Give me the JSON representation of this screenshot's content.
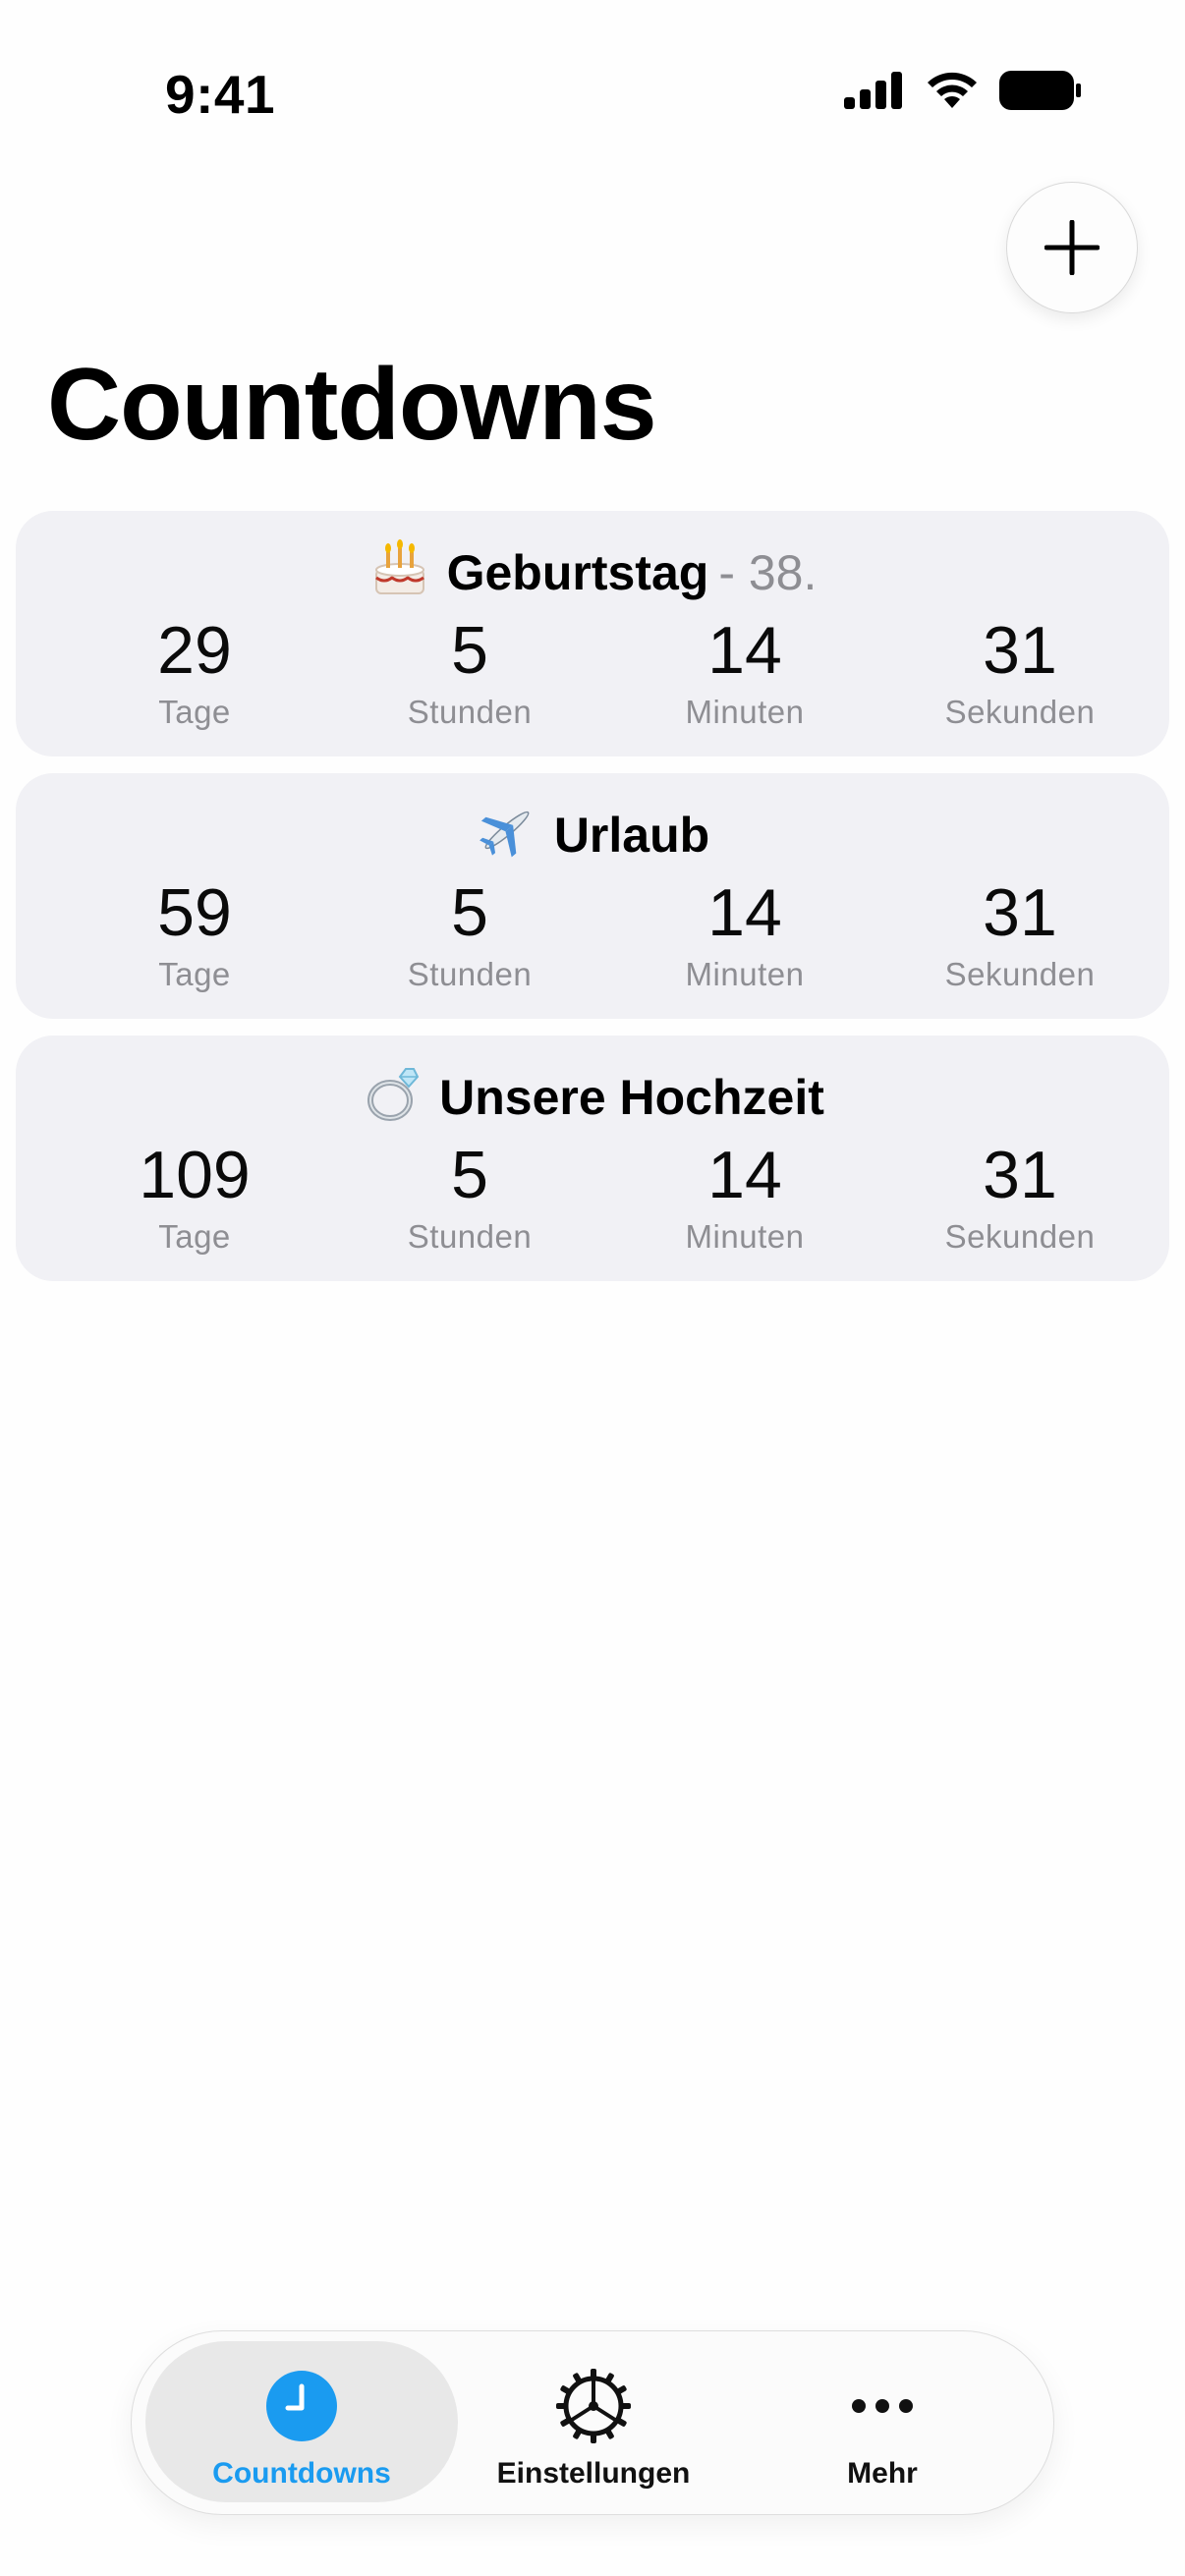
{
  "status_bar": {
    "time": "9:41",
    "icons": [
      "cellular-signal-icon",
      "wifi-icon",
      "battery-icon"
    ]
  },
  "header": {
    "add_button_icon": "plus-icon",
    "title": "Countdowns"
  },
  "countdowns": [
    {
      "emoji": "birthday-cake-icon",
      "title": "Geburtstag",
      "subtitle": "- 38.",
      "days": "29",
      "hours": "5",
      "minutes": "14",
      "seconds": "31"
    },
    {
      "emoji": "airplane-icon",
      "title": "Urlaub",
      "subtitle": "",
      "days": "59",
      "hours": "5",
      "minutes": "14",
      "seconds": "31"
    },
    {
      "emoji": "ring-icon",
      "title": "Unsere Hochzeit",
      "subtitle": "",
      "days": "109",
      "hours": "5",
      "minutes": "14",
      "seconds": "31"
    }
  ],
  "unit_labels": {
    "days": "Tage",
    "hours": "Stunden",
    "minutes": "Minuten",
    "seconds": "Sekunden"
  },
  "tab_bar": {
    "tabs": [
      {
        "label": "Countdowns",
        "icon": "clock-icon",
        "active": true
      },
      {
        "label": "Einstellungen",
        "icon": "gear-icon",
        "active": false
      },
      {
        "label": "Mehr",
        "icon": "more-dots-icon",
        "active": false
      }
    ]
  },
  "colors": {
    "accent": "#1a9bf0",
    "card_background": "#f1f1f5",
    "secondary_text": "#8e8e93"
  }
}
